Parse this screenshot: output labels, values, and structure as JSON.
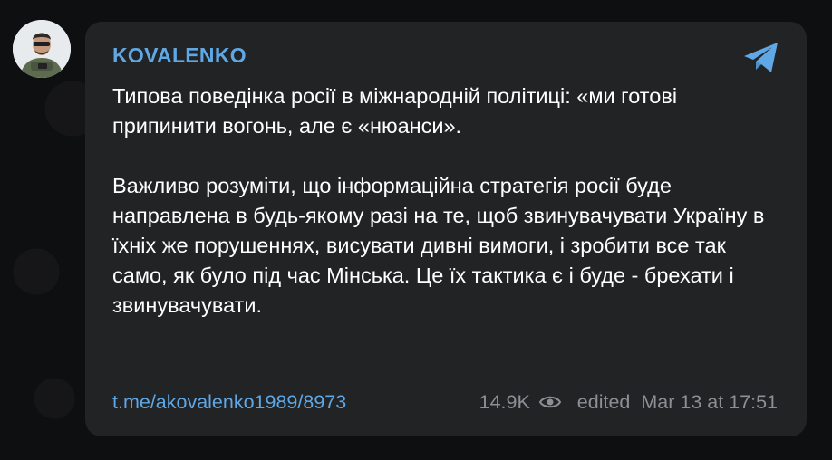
{
  "message": {
    "sender": "KOVALENKO",
    "paragraphs": [
      "Типова поведінка росії в міжнародній політиці: «ми готові припинити вогонь, але є «нюанси».",
      "Важливо розуміти, що інформаційна стратегія росії буде направлена в будь-якому разі на те, щоб звинувачувати Україну в їхніх же порушеннях, висувати дивні вимоги, і зробити все так само, як було під час Мінська. Це їх тактика є і буде - брехати і звинувачувати."
    ],
    "link": "t.me/akovalenko1989/8973",
    "views": "14.9K",
    "edited": "edited",
    "timestamp": "Mar 13 at 17:51"
  },
  "icons": {
    "share": "share-arrow-icon",
    "views": "eye-icon"
  },
  "colors": {
    "accent": "#5fa8e5",
    "bubble": "#222325",
    "background": "#0e0f11",
    "meta": "#8c8f94"
  }
}
